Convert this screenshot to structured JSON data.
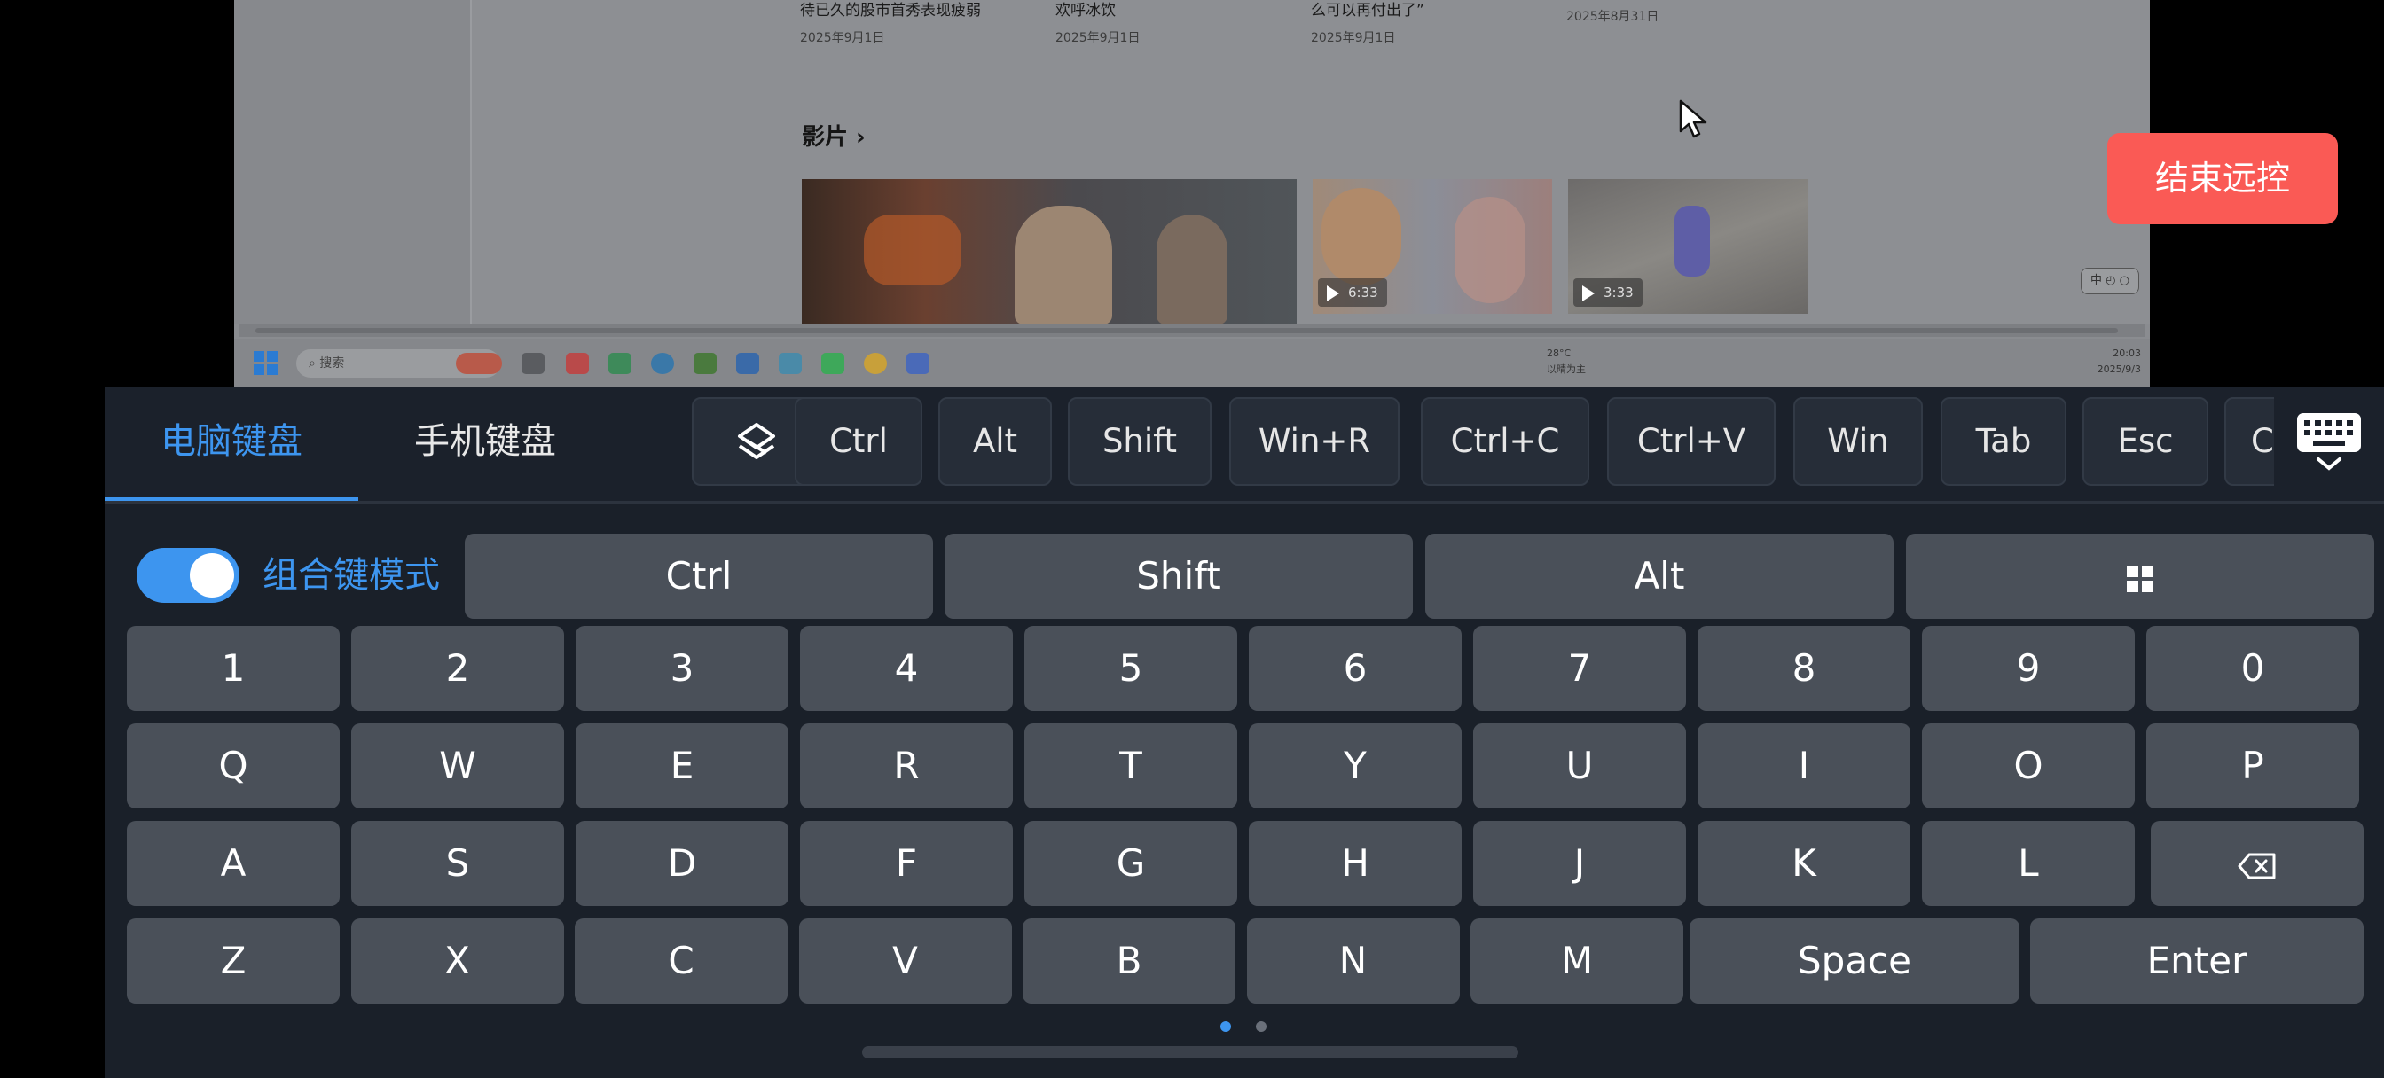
{
  "remote": {
    "news": [
      {
        "title": "待已久的股市首秀表现疲弱",
        "date": "2025年9月1日"
      },
      {
        "title": "欢呼冰饮",
        "date": "2025年9月1日"
      },
      {
        "title": "么可以再付出了”",
        "date": "2025年9月1日"
      },
      {
        "title": "",
        "date": "2025年8月31日"
      }
    ],
    "section_title": "影片 ›",
    "videos": [
      {
        "duration": ""
      },
      {
        "duration": "6:33"
      },
      {
        "duration": "3:33"
      }
    ],
    "ime_label": "中 ◴ ○",
    "taskbar": {
      "search_placeholder": "搜索",
      "weather": "28°C",
      "weather_desc": "以晴为主",
      "time": "20:03",
      "date": "2025/9/3"
    }
  },
  "end_remote_label": "结束远控",
  "keyboard": {
    "tabs": [
      {
        "label": "电脑键盘",
        "active": true
      },
      {
        "label": "手机键盘",
        "active": false
      }
    ],
    "quick_keys": [
      "Ctrl",
      "Alt",
      "Shift",
      "Win+R",
      "Ctrl+C",
      "Ctrl+V",
      "Win",
      "Tab",
      "Esc",
      "C"
    ],
    "combo_mode_label": "组合键模式",
    "combo_mode_on": true,
    "modifiers": [
      "Ctrl",
      "Shift",
      "Alt"
    ],
    "row_numbers": [
      "1",
      "2",
      "3",
      "4",
      "5",
      "6",
      "7",
      "8",
      "9",
      "0"
    ],
    "row_top": [
      "Q",
      "W",
      "E",
      "R",
      "T",
      "Y",
      "U",
      "I",
      "O",
      "P"
    ],
    "row_home": [
      "A",
      "S",
      "D",
      "F",
      "G",
      "H",
      "J",
      "K",
      "L"
    ],
    "row_bottom": [
      "Z",
      "X",
      "C",
      "V",
      "B",
      "N",
      "M"
    ],
    "space_label": "Space",
    "enter_label": "Enter",
    "page_count": 2,
    "current_page": 1
  },
  "colors": {
    "accent": "#3d95ef",
    "end_button": "#fa5a55",
    "key": "#4a5059",
    "panel": "#1a2029"
  }
}
